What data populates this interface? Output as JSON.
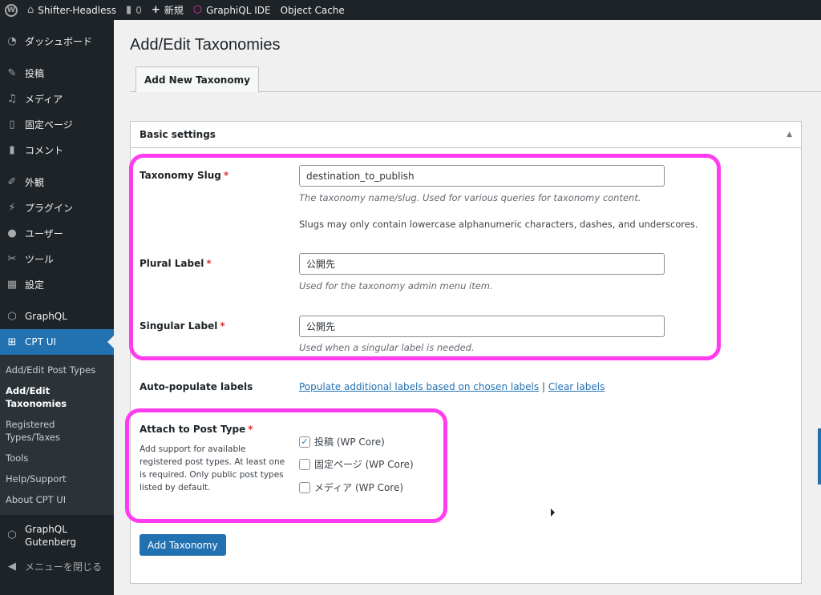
{
  "adminbar": {
    "wp_icon": "wordpress-logo-icon",
    "site_name": "Shifter-Headless",
    "comments_count": "0",
    "new_label": "新規",
    "graphiql_label": "GraphiQL IDE",
    "object_cache_label": "Object Cache"
  },
  "sidebar": {
    "items": [
      {
        "icon": "dashboard-icon",
        "label": "ダッシュボード"
      },
      {
        "icon": "pin-icon",
        "label": "投稿"
      },
      {
        "icon": "media-icon",
        "label": "メディア"
      },
      {
        "icon": "page-icon",
        "label": "固定ページ"
      },
      {
        "icon": "comment-icon",
        "label": "コメント"
      },
      {
        "icon": "appearance-icon",
        "label": "外観"
      },
      {
        "icon": "plugin-icon",
        "label": "プラグイン"
      },
      {
        "icon": "user-icon",
        "label": "ユーザー"
      },
      {
        "icon": "wrench-icon",
        "label": "ツール"
      },
      {
        "icon": "settings-icon",
        "label": "設定"
      },
      {
        "icon": "graphql-icon",
        "label": "GraphQL"
      },
      {
        "icon": "cptui-icon",
        "label": "CPT UI"
      }
    ],
    "submenu": [
      {
        "label": "Add/Edit Post Types"
      },
      {
        "label": "Add/Edit Taxonomies"
      },
      {
        "label": "Registered Types/Taxes"
      },
      {
        "label": "Tools"
      },
      {
        "label": "Help/Support"
      },
      {
        "label": "About CPT UI"
      }
    ],
    "graphql_gutenberg": "GraphQL Gutenberg",
    "collapse_label": "メニューを閉じる"
  },
  "page": {
    "title": "Add/Edit Taxonomies",
    "tab_label": "Add New Taxonomy",
    "section_title": "Basic settings"
  },
  "form": {
    "slug_label": "Taxonomy Slug",
    "slug_value": "destination_to_publish",
    "slug_desc": "The taxonomy name/slug. Used for various queries for taxonomy content.",
    "slug_note": "Slugs may only contain lowercase alphanumeric characters, dashes, and underscores.",
    "plural_label": "Plural Label",
    "plural_value": "公開先",
    "plural_desc": "Used for the taxonomy admin menu item.",
    "singular_label": "Singular Label",
    "singular_value": "公開先",
    "singular_desc": "Used when a singular label is needed.",
    "autopop_label": "Auto-populate labels",
    "autopop_link": "Populate additional labels based on chosen labels",
    "autopop_sep": "|",
    "clear_link": "Clear labels",
    "attach_label": "Attach to Post Type",
    "attach_help": "Add support for available registered post types. At least one is required. Only public post types listed by default.",
    "required_mark": "*",
    "post_types": [
      {
        "label": "投稿 (WP Core)",
        "checked": true
      },
      {
        "label": "固定ページ (WP Core)",
        "checked": false
      },
      {
        "label": "メディア (WP Core)",
        "checked": false
      }
    ],
    "submit_label": "Add Taxonomy"
  },
  "colors": {
    "highlight": "#ff3cf0",
    "accent": "#2271b1",
    "adminbar": "#1d2327"
  }
}
